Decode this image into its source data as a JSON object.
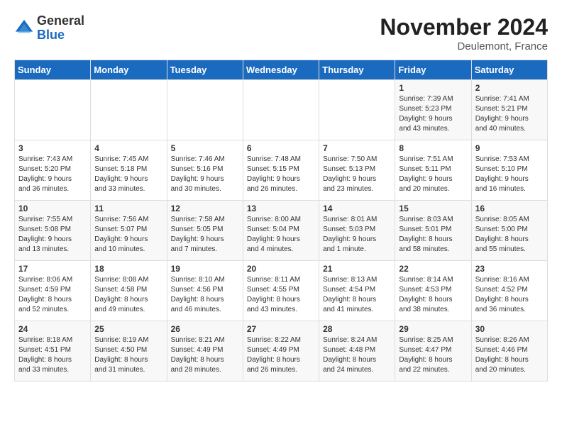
{
  "logo": {
    "general": "General",
    "blue": "Blue"
  },
  "title": "November 2024",
  "location": "Deulemont, France",
  "days_of_week": [
    "Sunday",
    "Monday",
    "Tuesday",
    "Wednesday",
    "Thursday",
    "Friday",
    "Saturday"
  ],
  "weeks": [
    [
      {
        "day": "",
        "info": ""
      },
      {
        "day": "",
        "info": ""
      },
      {
        "day": "",
        "info": ""
      },
      {
        "day": "",
        "info": ""
      },
      {
        "day": "",
        "info": ""
      },
      {
        "day": "1",
        "info": "Sunrise: 7:39 AM\nSunset: 5:23 PM\nDaylight: 9 hours\nand 43 minutes."
      },
      {
        "day": "2",
        "info": "Sunrise: 7:41 AM\nSunset: 5:21 PM\nDaylight: 9 hours\nand 40 minutes."
      }
    ],
    [
      {
        "day": "3",
        "info": "Sunrise: 7:43 AM\nSunset: 5:20 PM\nDaylight: 9 hours\nand 36 minutes."
      },
      {
        "day": "4",
        "info": "Sunrise: 7:45 AM\nSunset: 5:18 PM\nDaylight: 9 hours\nand 33 minutes."
      },
      {
        "day": "5",
        "info": "Sunrise: 7:46 AM\nSunset: 5:16 PM\nDaylight: 9 hours\nand 30 minutes."
      },
      {
        "day": "6",
        "info": "Sunrise: 7:48 AM\nSunset: 5:15 PM\nDaylight: 9 hours\nand 26 minutes."
      },
      {
        "day": "7",
        "info": "Sunrise: 7:50 AM\nSunset: 5:13 PM\nDaylight: 9 hours\nand 23 minutes."
      },
      {
        "day": "8",
        "info": "Sunrise: 7:51 AM\nSunset: 5:11 PM\nDaylight: 9 hours\nand 20 minutes."
      },
      {
        "day": "9",
        "info": "Sunrise: 7:53 AM\nSunset: 5:10 PM\nDaylight: 9 hours\nand 16 minutes."
      }
    ],
    [
      {
        "day": "10",
        "info": "Sunrise: 7:55 AM\nSunset: 5:08 PM\nDaylight: 9 hours\nand 13 minutes."
      },
      {
        "day": "11",
        "info": "Sunrise: 7:56 AM\nSunset: 5:07 PM\nDaylight: 9 hours\nand 10 minutes."
      },
      {
        "day": "12",
        "info": "Sunrise: 7:58 AM\nSunset: 5:05 PM\nDaylight: 9 hours\nand 7 minutes."
      },
      {
        "day": "13",
        "info": "Sunrise: 8:00 AM\nSunset: 5:04 PM\nDaylight: 9 hours\nand 4 minutes."
      },
      {
        "day": "14",
        "info": "Sunrise: 8:01 AM\nSunset: 5:03 PM\nDaylight: 9 hours\nand 1 minute."
      },
      {
        "day": "15",
        "info": "Sunrise: 8:03 AM\nSunset: 5:01 PM\nDaylight: 8 hours\nand 58 minutes."
      },
      {
        "day": "16",
        "info": "Sunrise: 8:05 AM\nSunset: 5:00 PM\nDaylight: 8 hours\nand 55 minutes."
      }
    ],
    [
      {
        "day": "17",
        "info": "Sunrise: 8:06 AM\nSunset: 4:59 PM\nDaylight: 8 hours\nand 52 minutes."
      },
      {
        "day": "18",
        "info": "Sunrise: 8:08 AM\nSunset: 4:58 PM\nDaylight: 8 hours\nand 49 minutes."
      },
      {
        "day": "19",
        "info": "Sunrise: 8:10 AM\nSunset: 4:56 PM\nDaylight: 8 hours\nand 46 minutes."
      },
      {
        "day": "20",
        "info": "Sunrise: 8:11 AM\nSunset: 4:55 PM\nDaylight: 8 hours\nand 43 minutes."
      },
      {
        "day": "21",
        "info": "Sunrise: 8:13 AM\nSunset: 4:54 PM\nDaylight: 8 hours\nand 41 minutes."
      },
      {
        "day": "22",
        "info": "Sunrise: 8:14 AM\nSunset: 4:53 PM\nDaylight: 8 hours\nand 38 minutes."
      },
      {
        "day": "23",
        "info": "Sunrise: 8:16 AM\nSunset: 4:52 PM\nDaylight: 8 hours\nand 36 minutes."
      }
    ],
    [
      {
        "day": "24",
        "info": "Sunrise: 8:18 AM\nSunset: 4:51 PM\nDaylight: 8 hours\nand 33 minutes."
      },
      {
        "day": "25",
        "info": "Sunrise: 8:19 AM\nSunset: 4:50 PM\nDaylight: 8 hours\nand 31 minutes."
      },
      {
        "day": "26",
        "info": "Sunrise: 8:21 AM\nSunset: 4:49 PM\nDaylight: 8 hours\nand 28 minutes."
      },
      {
        "day": "27",
        "info": "Sunrise: 8:22 AM\nSunset: 4:49 PM\nDaylight: 8 hours\nand 26 minutes."
      },
      {
        "day": "28",
        "info": "Sunrise: 8:24 AM\nSunset: 4:48 PM\nDaylight: 8 hours\nand 24 minutes."
      },
      {
        "day": "29",
        "info": "Sunrise: 8:25 AM\nSunset: 4:47 PM\nDaylight: 8 hours\nand 22 minutes."
      },
      {
        "day": "30",
        "info": "Sunrise: 8:26 AM\nSunset: 4:46 PM\nDaylight: 8 hours\nand 20 minutes."
      }
    ]
  ]
}
